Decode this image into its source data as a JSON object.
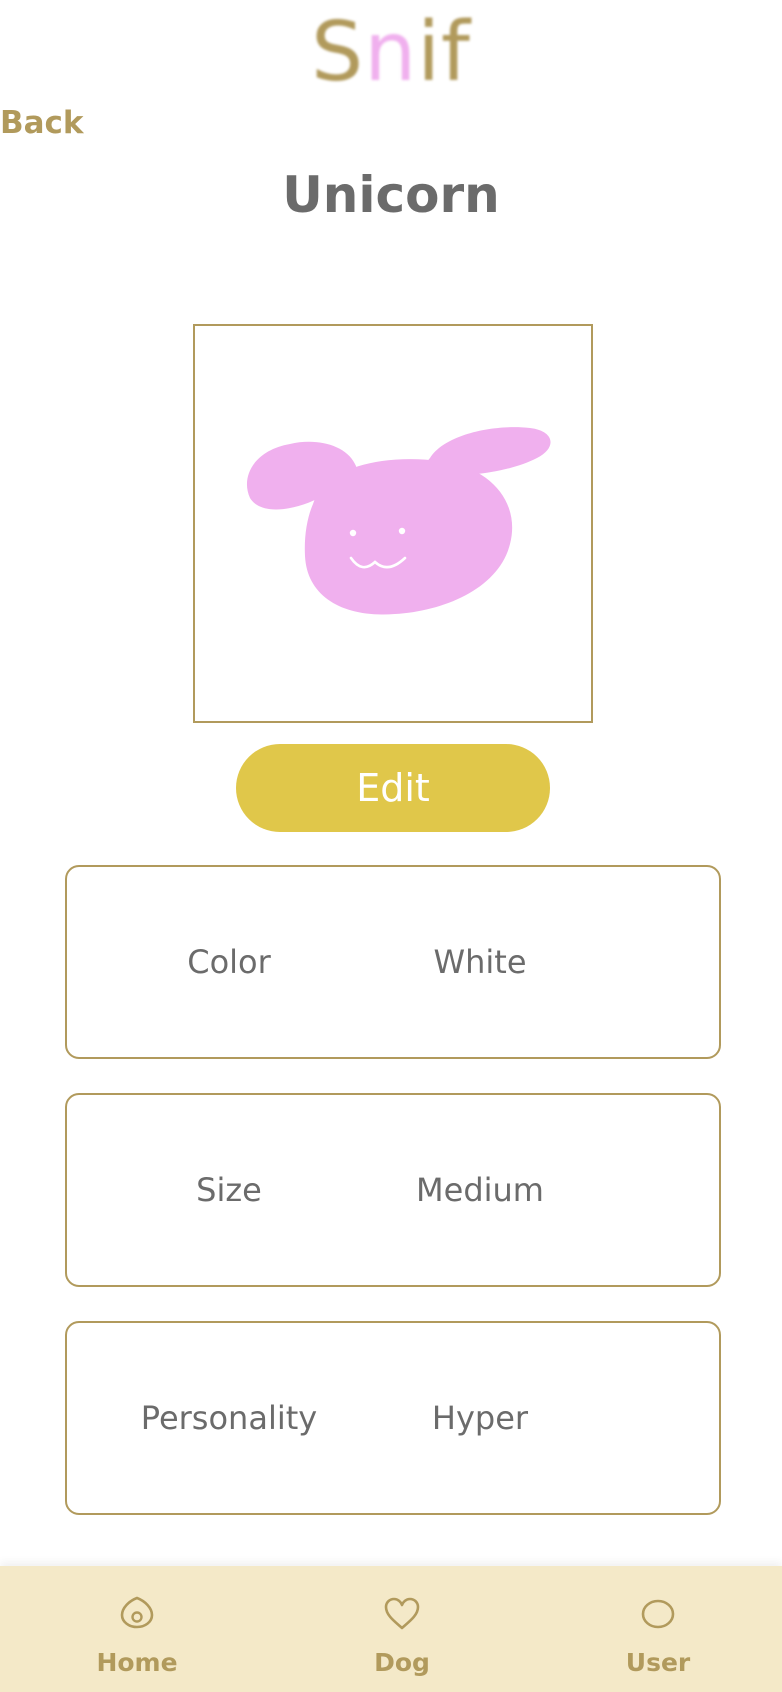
{
  "colors": {
    "gold": "#b19a5c",
    "pink": "#f0b0ee",
    "yellow": "#e0c74a",
    "text_gray": "#6b6b6b",
    "tabbar_bg": "#f4e9c8",
    "white": "#ffffff"
  },
  "header": {
    "logo_letters": [
      "S",
      "n",
      "i",
      "f"
    ],
    "back_label": "Back"
  },
  "profile": {
    "dog_name": "Unicorn",
    "photo_icon": "bunny-face-icon",
    "edit_label": "Edit"
  },
  "attributes": [
    {
      "label": "Color",
      "value": "White"
    },
    {
      "label": "Size",
      "value": "Medium"
    },
    {
      "label": "Personality",
      "value": "Hyper"
    }
  ],
  "tabbar": {
    "items": [
      {
        "label": "Home",
        "icon": "home-icon"
      },
      {
        "label": "Dog",
        "icon": "heart-icon"
      },
      {
        "label": "User",
        "icon": "user-icon"
      }
    ]
  }
}
